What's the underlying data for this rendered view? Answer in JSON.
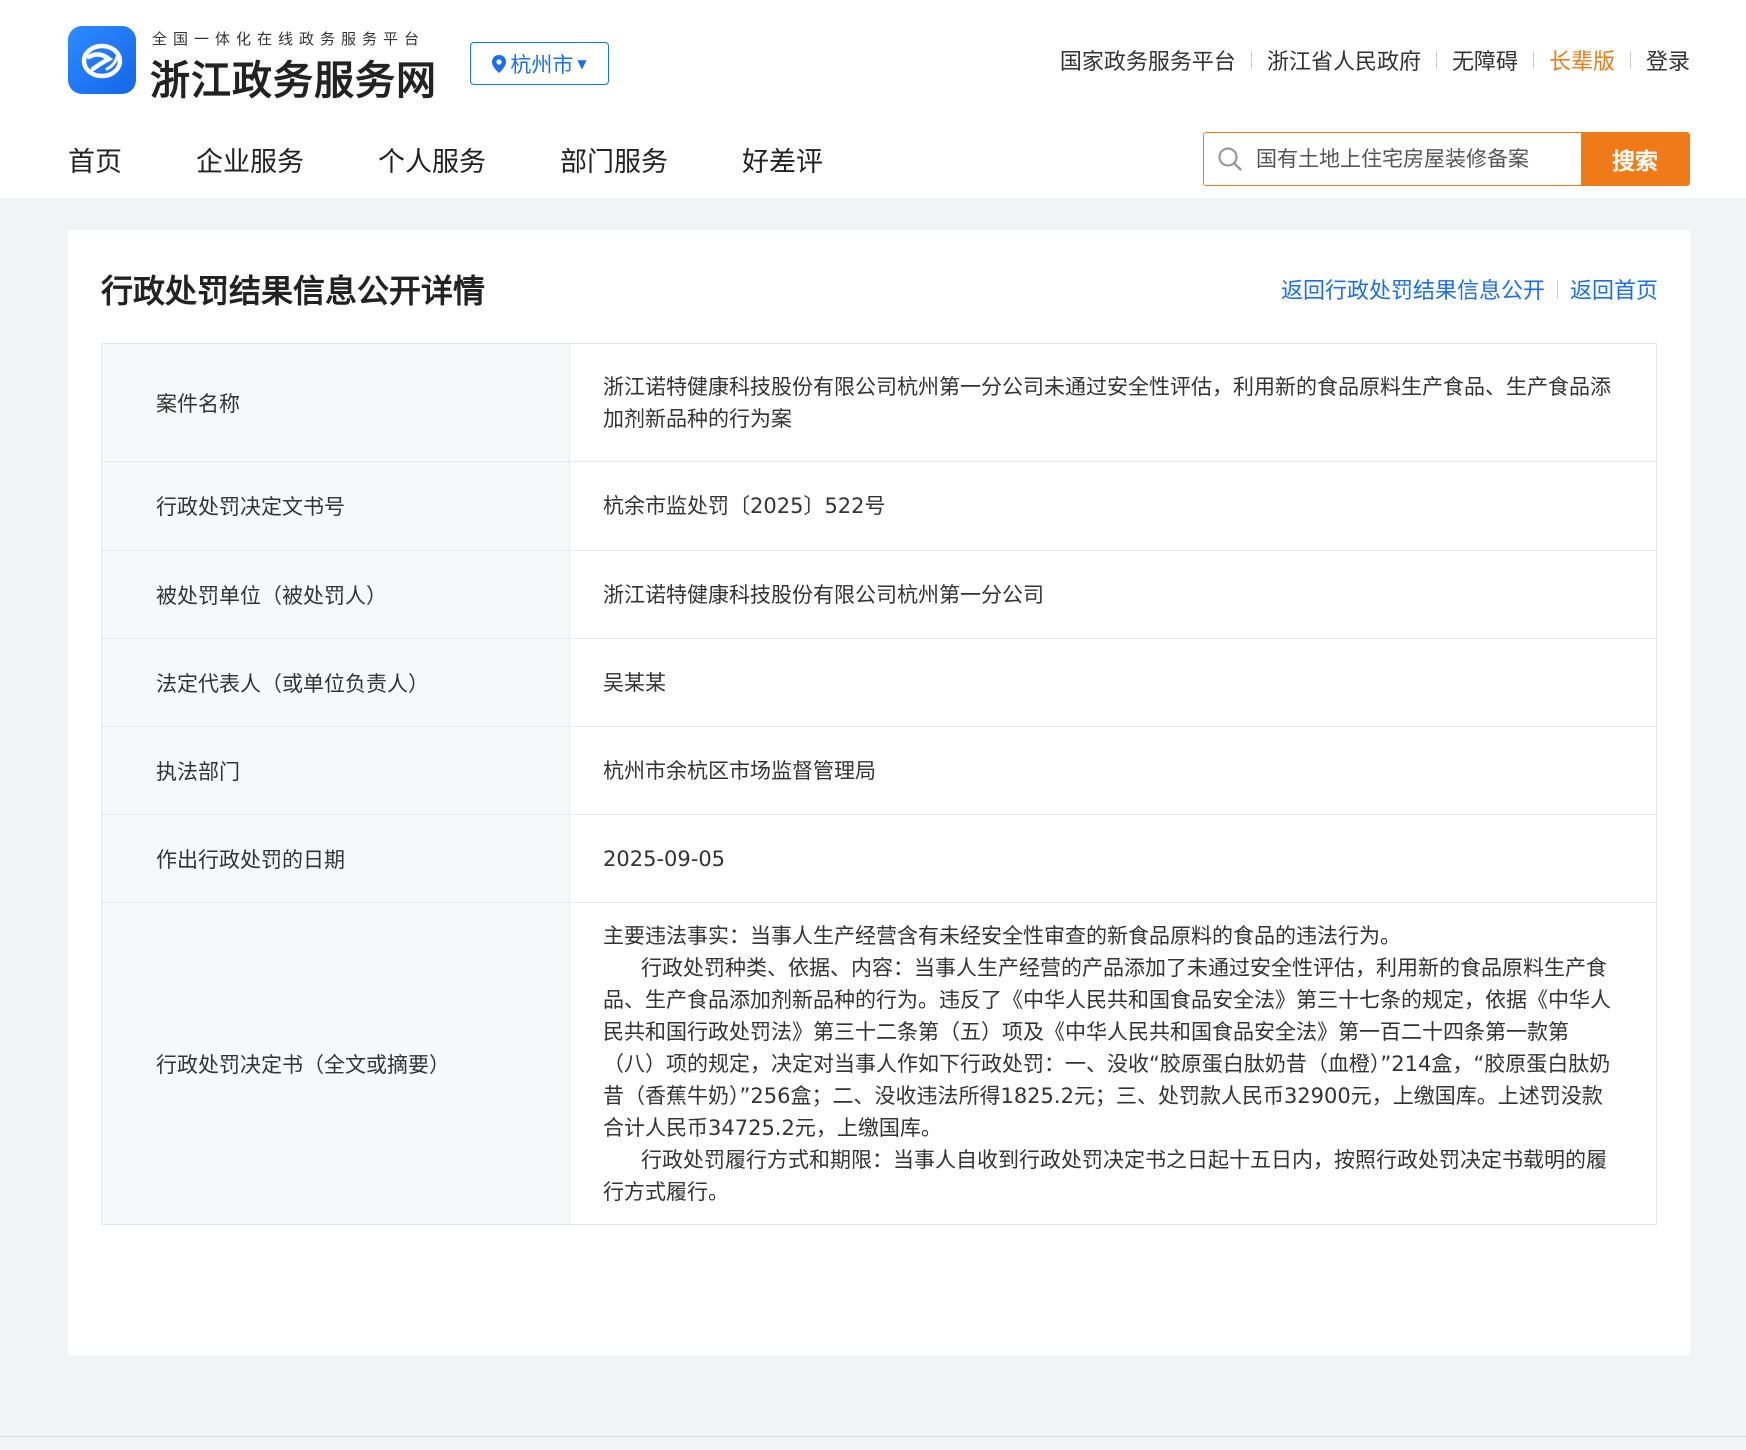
{
  "header": {
    "platform_subtitle": "全国一体化在线政务服务平台",
    "site_title": "浙江政务服务网",
    "city": "杭州市",
    "top_links": [
      {
        "label": "国家政务服务平台"
      },
      {
        "label": "浙江省人民政府"
      },
      {
        "label": "无障碍"
      },
      {
        "label": "长辈版"
      },
      {
        "label": "登录"
      }
    ]
  },
  "nav": {
    "items": [
      "首页",
      "企业服务",
      "个人服务",
      "部门服务",
      "好差评"
    ]
  },
  "search": {
    "placeholder": "国有土地上住宅房屋装修备案",
    "button_label": "搜索"
  },
  "main": {
    "title": "行政处罚结果信息公开详情",
    "back_links": [
      "返回行政处罚结果信息公开",
      "返回首页"
    ],
    "rows": [
      {
        "label": "案件名称",
        "value": "浙江诺特健康科技股份有限公司杭州第一分公司未通过安全性评估，利用新的食品原料生产食品、生产食品添加剂新品种的行为案"
      },
      {
        "label": "行政处罚决定文书号",
        "value": "杭余市监处罚〔2025〕522号"
      },
      {
        "label": "被处罚单位（被处罚人）",
        "value": "浙江诺特健康科技股份有限公司杭州第一分公司"
      },
      {
        "label": "法定代表人（或单位负责人）",
        "value": "吴某某"
      },
      {
        "label": "执法部门",
        "value": "杭州市余杭区市场监督管理局"
      },
      {
        "label": "作出行政处罚的日期",
        "value": "2025-09-05"
      }
    ],
    "decision": {
      "label": "行政处罚决定书（全文或摘要）",
      "paragraphs": [
        "主要违法事实：当事人生产经营含有未经安全性审查的新食品原料的食品的违法行为。",
        "行政处罚种类、依据、内容：当事人生产经营的产品添加了未通过安全性评估，利用新的食品原料生产食品、生产食品添加剂新品种的行为。违反了《中华人民共和国食品安全法》第三十七条的规定，依据《中华人民共和国行政处罚法》第三十二条第（五）项及《中华人民共和国食品安全法》第一百二十四条第一款第（八）项的规定，决定对当事人作如下行政处罚：一、没收“胶原蛋白肽奶昔（血橙）”214盒，“胶原蛋白肽奶昔（香蕉牛奶）”256盒；二、没收违法所得1825.2元；三、处罚款人民币32900元，上缴国库。上述罚没款合计人民币34725.2元，上缴国库。",
        "行政处罚履行方式和期限：当事人自收到行政处罚决定书之日起十五日内，按照行政处罚决定书载明的履行方式履行。"
      ]
    }
  },
  "colors": {
    "brand_blue": "#1a6ef0",
    "accent_orange": "#f07a17"
  },
  "icons": {
    "logo": "zhejiang-gov-logo-icon",
    "location": "location-pin-icon",
    "dropdown": "caret-down-icon",
    "search": "search-icon"
  }
}
